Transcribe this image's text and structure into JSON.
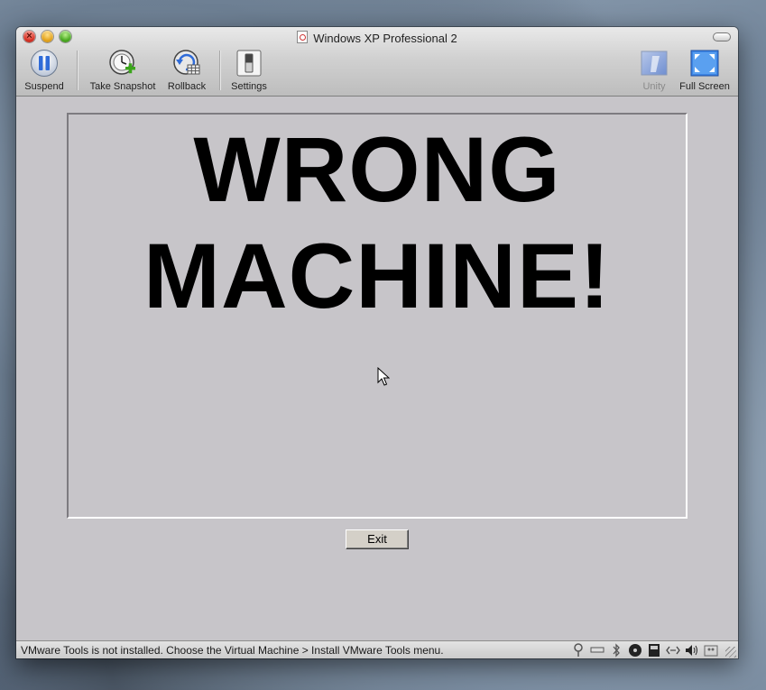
{
  "window": {
    "title": "Windows XP Professional 2"
  },
  "toolbar": {
    "suspend_label": "Suspend",
    "snapshot_label": "Take Snapshot",
    "rollback_label": "Rollback",
    "settings_label": "Settings",
    "unity_label": "Unity",
    "fullscreen_label": "Full Screen"
  },
  "vm": {
    "message_line1": "WRONG",
    "message_line2": "MACHINE!",
    "exit_label": "Exit"
  },
  "status": {
    "message": "VMware Tools is not installed. Choose the Virtual Machine > Install VMware Tools menu.",
    "icons": [
      "usb-icon",
      "hard-disk-icon",
      "bluetooth-icon",
      "cd-dvd-icon",
      "floppy-icon",
      "network-icon",
      "sound-icon",
      "shared-folders-icon"
    ]
  },
  "colors": {
    "vm_background": "#c7c5c9",
    "accent_blue": "#2f6bd8"
  }
}
